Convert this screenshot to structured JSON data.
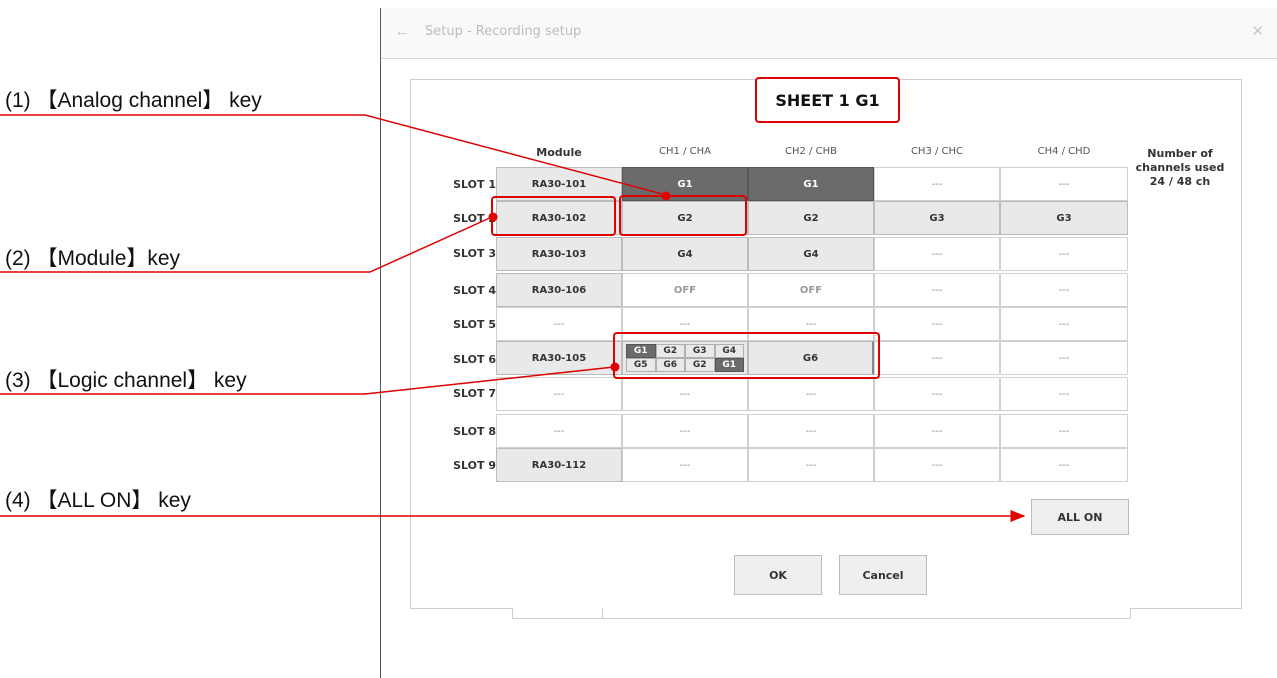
{
  "window": {
    "title": "Setup - Recording setup",
    "back_icon": "arrow-left-icon",
    "close_icon": "close-icon"
  },
  "sheet_label": "SHEET 1  G1",
  "columns": {
    "module": "Module",
    "ch1": "CH1 / CHA",
    "ch2": "CH2 / CHB",
    "ch3": "CH3 / CHC",
    "ch4": "CH4 / CHD"
  },
  "channels_used": {
    "line1": "Number of",
    "line2": "channels used",
    "value": "24 / 48 ch"
  },
  "slots": [
    {
      "label": "SLOT 1",
      "module": "RA30-101",
      "ch": [
        "G1",
        "G1",
        "---",
        "---"
      ]
    },
    {
      "label": "SLOT 2",
      "module": "RA30-102",
      "ch": [
        "G2",
        "G2",
        "G3",
        "G3"
      ]
    },
    {
      "label": "SLOT 3",
      "module": "RA30-103",
      "ch": [
        "G4",
        "G4",
        "---",
        "---"
      ]
    },
    {
      "label": "SLOT 4",
      "module": "RA30-106",
      "ch": [
        "OFF",
        "OFF",
        "---",
        "---"
      ]
    },
    {
      "label": "SLOT 5",
      "module": "---",
      "ch": [
        "---",
        "---",
        "---",
        "---"
      ]
    },
    {
      "label": "SLOT 6",
      "module": "RA30-105",
      "ch": [
        "",
        "G6",
        "---",
        "---"
      ]
    },
    {
      "label": "SLOT 7",
      "module": "---",
      "ch": [
        "---",
        "---",
        "---",
        "---"
      ]
    },
    {
      "label": "SLOT 8",
      "module": "---",
      "ch": [
        "---",
        "---",
        "---",
        "---"
      ]
    },
    {
      "label": "SLOT 9",
      "module": "RA30-112",
      "ch": [
        "---",
        "---",
        "---",
        "---"
      ]
    }
  ],
  "logic_channels": [
    "G1",
    "G2",
    "G3",
    "G4",
    "G5",
    "G6",
    "G2",
    "G1"
  ],
  "buttons": {
    "all_on": "ALL ON",
    "ok": "OK",
    "cancel": "Cancel"
  },
  "callouts": [
    "(1) 【Analog channel】 key",
    "(2) 【Module】key",
    "(3) 【Logic channel】 key",
    "(4) 【ALL ON】 key"
  ],
  "colors": {
    "annotation_red": "#e00000",
    "key_dark": "#6b6b6b",
    "key_light": "#e9e9e9"
  }
}
